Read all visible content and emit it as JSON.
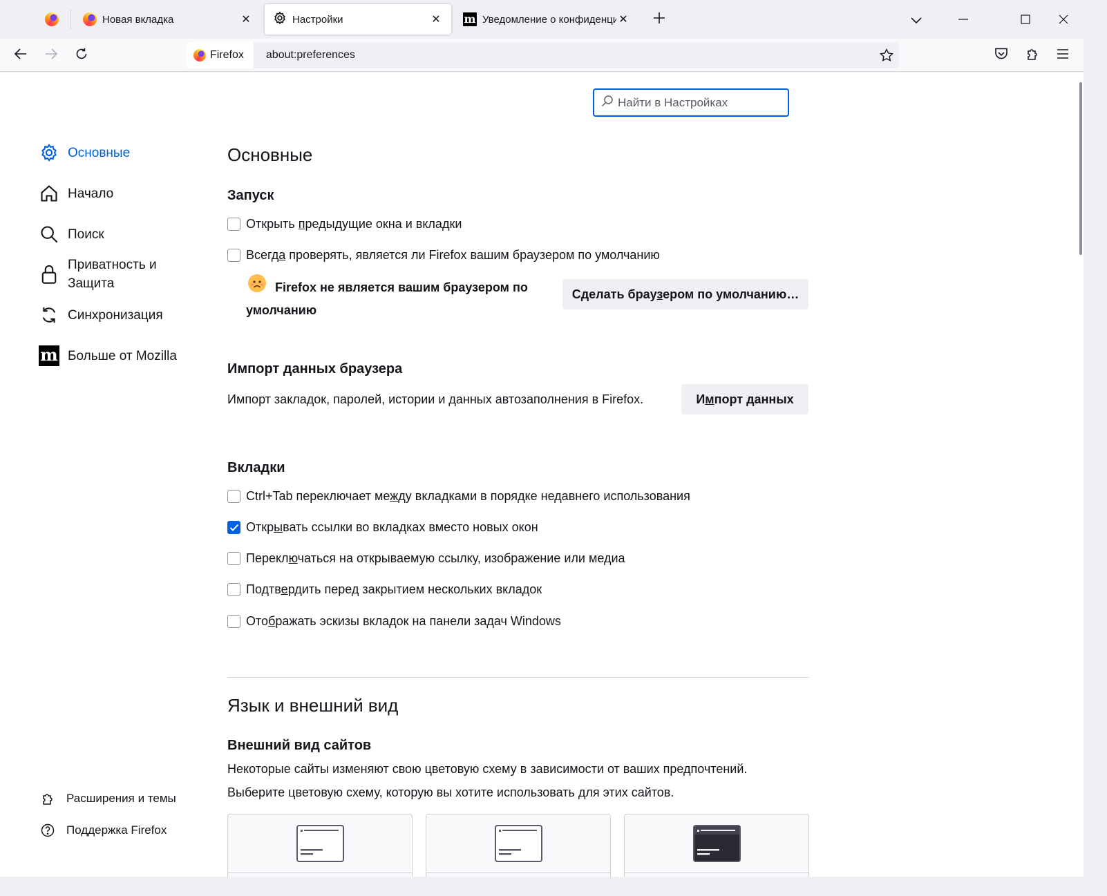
{
  "tabs": [
    {
      "title": "",
      "icon": "firefox-icon",
      "pinned": true
    },
    {
      "title": "Новая вкладка",
      "icon": "firefox-icon"
    },
    {
      "title": "Настройки",
      "icon": "gear-icon",
      "active": true
    },
    {
      "title": "Уведомление о конфиденциальности",
      "icon": "mozilla-icon"
    }
  ],
  "navbar": {
    "identity_label": "Firefox",
    "url": "about:preferences"
  },
  "search": {
    "placeholder": "Найти в Настройках"
  },
  "sidebar": {
    "categories": [
      {
        "label": "Основные",
        "icon": "gear-icon",
        "selected": true
      },
      {
        "label": "Начало",
        "icon": "home-icon"
      },
      {
        "label": "Поиск",
        "icon": "search-icon"
      },
      {
        "label": "Приватность и Защита",
        "line1": "Приватность и",
        "line2": "Защита",
        "icon": "lock-icon"
      },
      {
        "label": "Синхронизация",
        "icon": "sync-icon"
      },
      {
        "label": "Больше от Mozilla",
        "icon": "mozilla-icon"
      }
    ],
    "footer": [
      {
        "label": "Расширения и темы",
        "icon": "puzzle-icon"
      },
      {
        "label": "Поддержка Firefox",
        "icon": "help-icon"
      }
    ]
  },
  "main": {
    "title": "Основные",
    "startup": {
      "heading": "Запуск",
      "restore_pre": "Открыть ",
      "restore_key": "п",
      "restore_post": "редыдущие окна и вкладки",
      "restore_checked": false,
      "default_pre": "Всегд",
      "default_key": "а",
      "default_post": " проверять, является ли Firefox вашим браузером по умолчанию",
      "default_checked": false,
      "not_default_line1": "Firefox не является вашим браузером по",
      "not_default_line2": "умолчанию",
      "make_default_pre": "Сделать брау",
      "make_default_key": "з",
      "make_default_post": "ером по умолчанию…"
    },
    "import": {
      "heading": "Импорт данных браузера",
      "description": "Импорт закладок, паролей, истории и данных автозаполнения в Firefox.",
      "button_pre": "И",
      "button_key": "м",
      "button_post": "порт данных"
    },
    "tabs_section": {
      "heading": "Вкладки",
      "items": [
        {
          "pre": "Ctrl+Tab переключает ме",
          "key": "ж",
          "post": "ду вкладками в порядке недавнего использования",
          "checked": false
        },
        {
          "pre": "Откр",
          "key": "ы",
          "post": "вать ссылки во вкладках вместо новых окон",
          "checked": true
        },
        {
          "pre": "Перекл",
          "key": "ю",
          "post": "чаться на открываемую ссылку, изображение или медиа",
          "checked": false
        },
        {
          "pre": "Подтв",
          "key": "е",
          "post": "рдить перед закрытием нескольких вкладок",
          "checked": false
        },
        {
          "pre": "Ото",
          "key": "б",
          "post": "ражать эскизы вкладок на панели задач Windows",
          "checked": false
        }
      ]
    },
    "language": {
      "title": "Язык и внешний вид",
      "appearance_heading": "Внешний вид сайтов",
      "appearance_desc1": "Некоторые сайты изменяют свою цветовую схему в зависимости от ваших предпочтений.",
      "appearance_desc2": "Выберите цветовую схему, которую вы хотите использовать для этих сайтов."
    }
  },
  "colors": {
    "accent": "#0061e0",
    "text": "#15141a",
    "chrome_bg": "#f0f0f4"
  }
}
